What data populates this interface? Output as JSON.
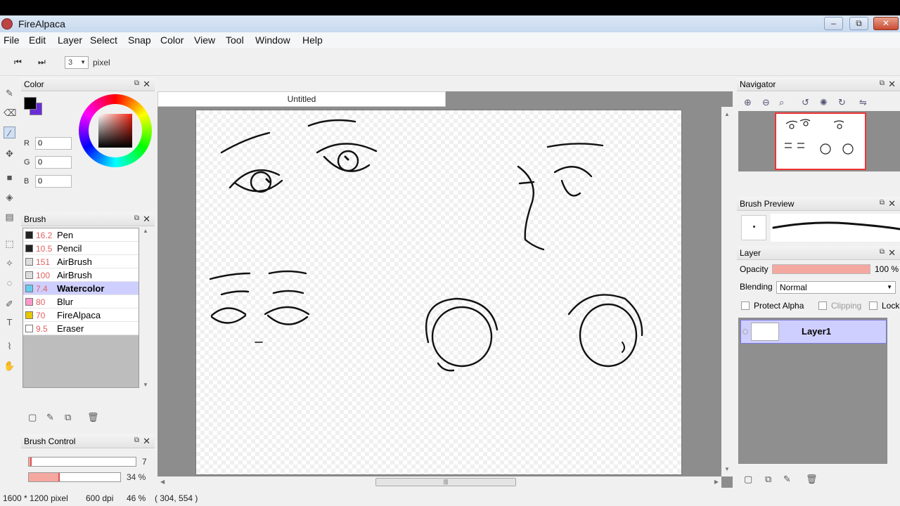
{
  "window": {
    "title": "FireAlpaca",
    "minimize_glyph": "–",
    "maximize_glyph": "⧉",
    "close_glyph": "✕"
  },
  "menu": [
    "File",
    "Edit",
    "Layer",
    "Select",
    "Snap",
    "Color",
    "View",
    "Tool",
    "Window",
    "Help"
  ],
  "toolbar": {
    "prev_glyph": "⏮",
    "next_glyph": "⏭",
    "size_value": "3",
    "size_unit": "pixel"
  },
  "color_panel": {
    "title": "Color",
    "r_label": "R",
    "r_value": "0",
    "g_label": "G",
    "g_value": "0",
    "b_label": "B",
    "b_value": "0"
  },
  "brush_panel": {
    "title": "Brush",
    "items": [
      {
        "size": "16.2",
        "name": "Pen",
        "swatch": "#222222"
      },
      {
        "size": "10.5",
        "name": "Pencil",
        "swatch": "#222222"
      },
      {
        "size": "151",
        "name": "AirBrush",
        "swatch": "#dddddd"
      },
      {
        "size": "100",
        "name": "AirBrush",
        "swatch": "#dddddd"
      },
      {
        "size": "7.4",
        "name": "Watercolor",
        "swatch": "#66ccee"
      },
      {
        "size": "80",
        "name": "Blur",
        "swatch": "#ff99cc"
      },
      {
        "size": "70",
        "name": "FireAlpaca",
        "swatch": "#e6c800"
      },
      {
        "size": "9.5",
        "name": "Eraser",
        "swatch": "#ffffff"
      }
    ],
    "selected_index": 4
  },
  "brush_control": {
    "title": "Brush Control",
    "size_value": "7",
    "size_fraction": 0.02,
    "opacity_value": "34 %",
    "opacity_fraction": 0.34
  },
  "document": {
    "tab_title": "Untitled",
    "scroll_grip": "|||"
  },
  "navigator": {
    "title": "Navigator"
  },
  "brush_preview": {
    "title": "Brush Preview"
  },
  "layer_panel": {
    "title": "Layer",
    "opacity_label": "Opacity",
    "opacity_value": "100 %",
    "blending_label": "Blending",
    "blending_value": "Normal",
    "protect_alpha": "Protect Alpha",
    "clipping": "Clipping",
    "lock": "Lock",
    "layers": [
      "Layer1"
    ]
  },
  "status": {
    "size": "1600 * 1200 pixel",
    "dpi": "600 dpi",
    "zoom": "46 %",
    "coords": "( 304, 554 )"
  }
}
